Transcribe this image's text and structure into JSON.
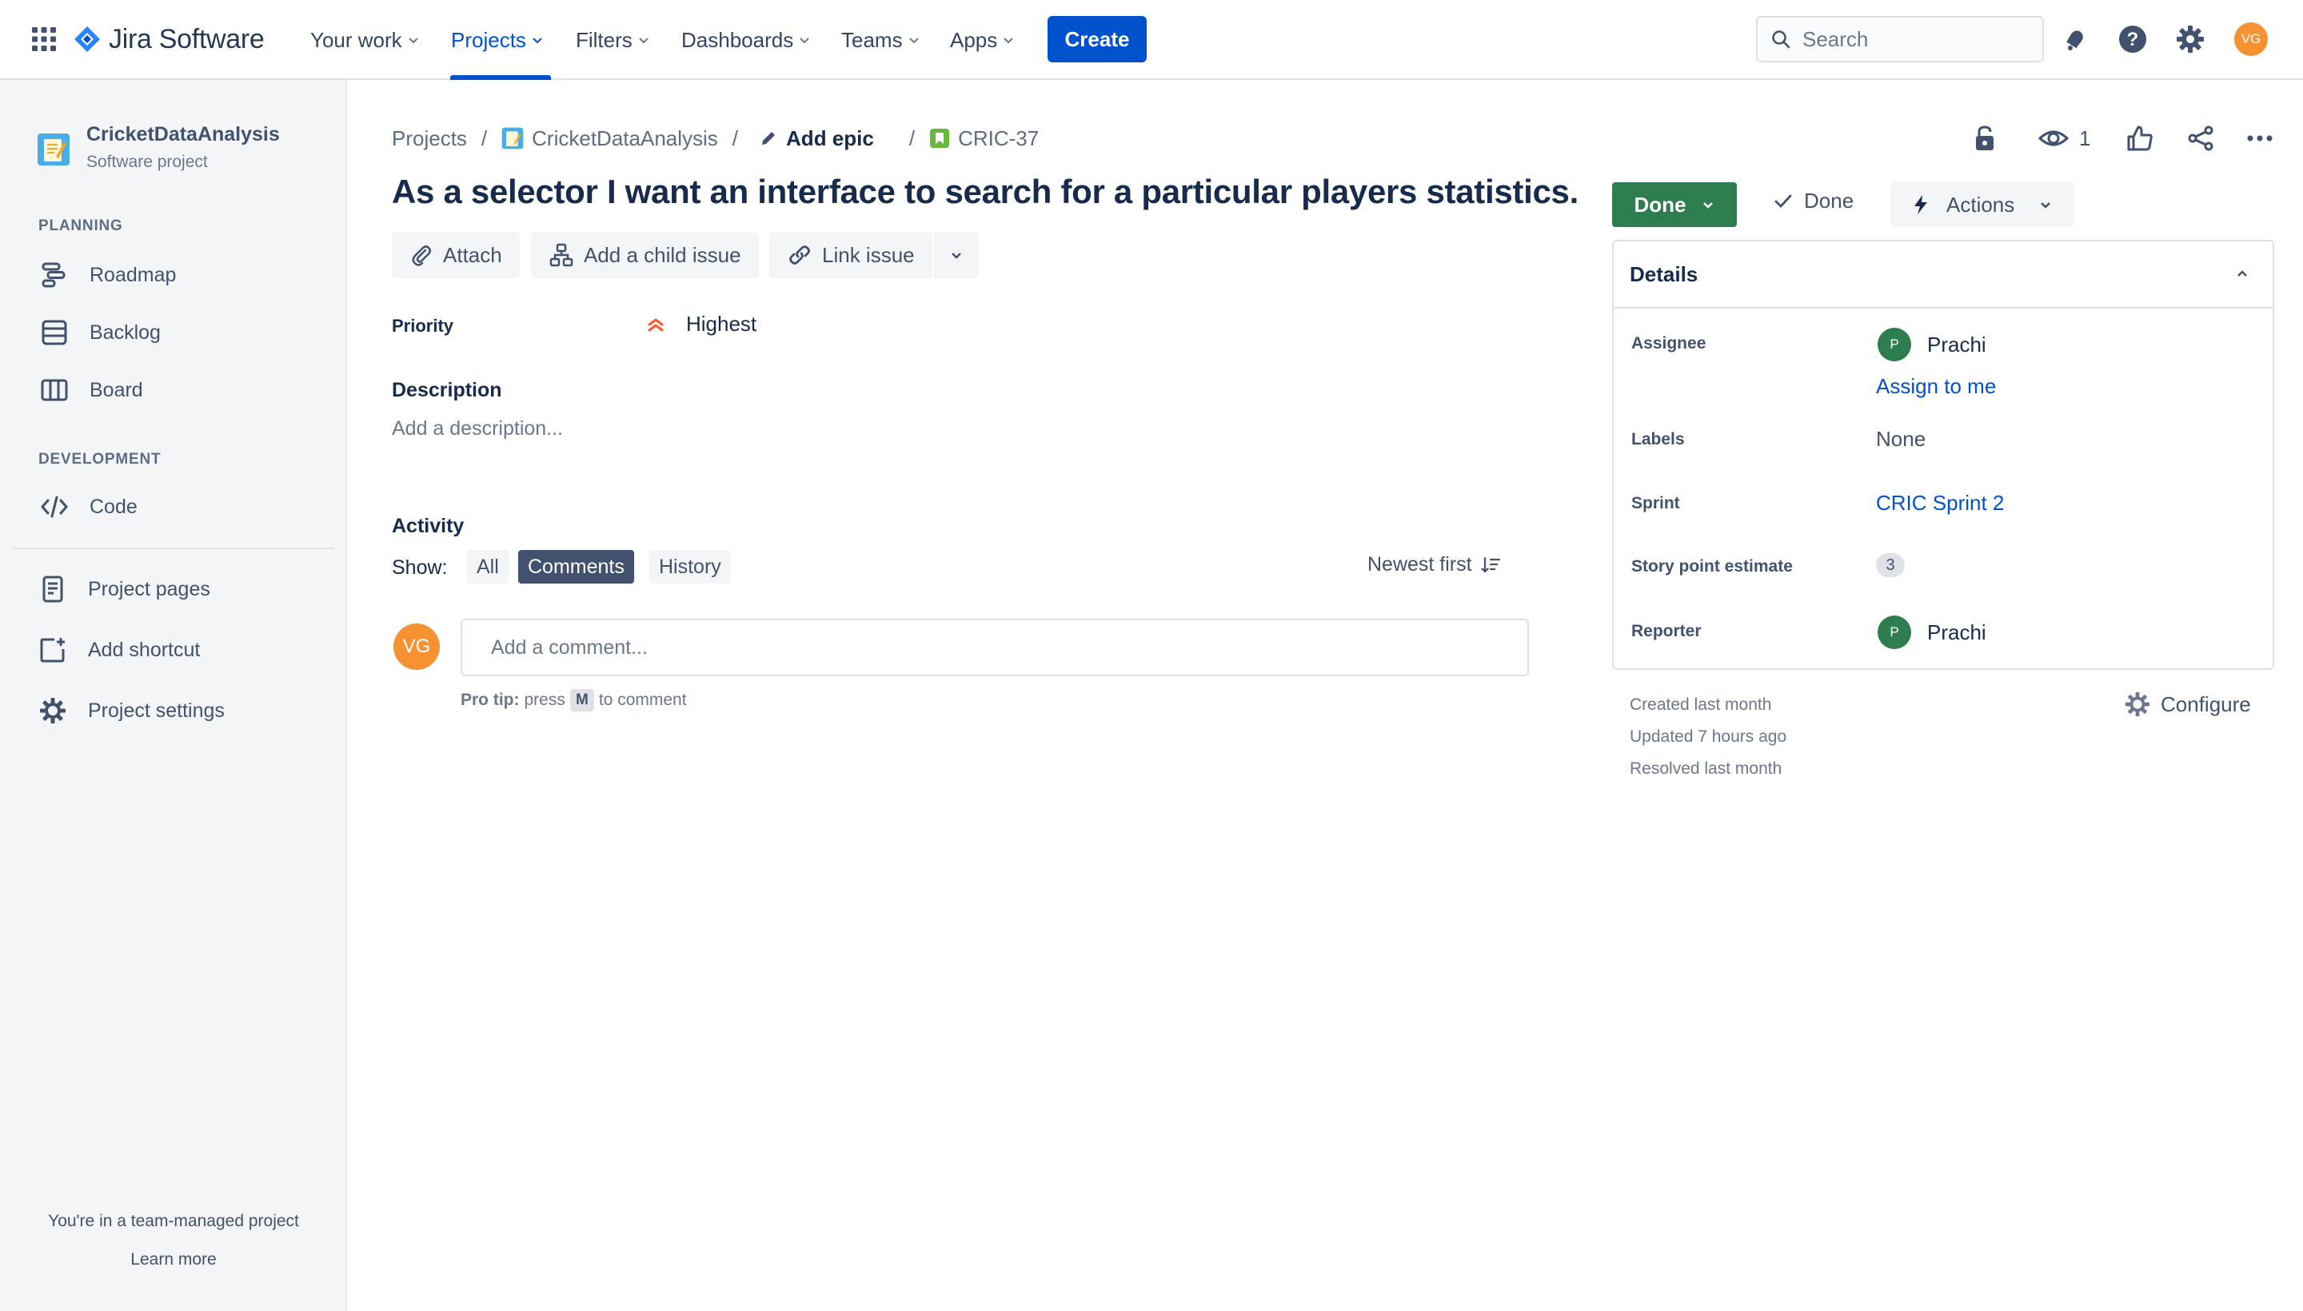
{
  "topnav": {
    "logo_text": "Jira Software",
    "items": [
      {
        "label": "Your work"
      },
      {
        "label": "Projects"
      },
      {
        "label": "Filters"
      },
      {
        "label": "Dashboards"
      },
      {
        "label": "Teams"
      },
      {
        "label": "Apps"
      }
    ],
    "active_item": "Projects",
    "create_label": "Create",
    "search_placeholder": "Search",
    "user_initials": "VG",
    "accent_color": "#0052CC"
  },
  "sidebar": {
    "project_name": "CricketDataAnalysis",
    "project_type": "Software project",
    "planning_heading": "PLANNING",
    "planning_items": [
      {
        "label": "Roadmap",
        "icon": "roadmap-icon"
      },
      {
        "label": "Backlog",
        "icon": "backlog-icon"
      },
      {
        "label": "Board",
        "icon": "board-icon"
      }
    ],
    "development_heading": "DEVELOPMENT",
    "development_items": [
      {
        "label": "Code",
        "icon": "code-icon"
      }
    ],
    "other_items": [
      {
        "label": "Project pages",
        "icon": "page-icon"
      },
      {
        "label": "Add shortcut",
        "icon": "add-shortcut-icon"
      },
      {
        "label": "Project settings",
        "icon": "gear-icon"
      }
    ],
    "footer_text": "You're in a team-managed project",
    "learn_more": "Learn more"
  },
  "issue": {
    "breadcrumb": {
      "projects": "Projects",
      "project": "CricketDataAnalysis",
      "epic": "Add epic",
      "key": "CRIC-37"
    },
    "title": "As a selector I want an interface to search for a particular players statistics.",
    "toolbar": {
      "attach": "Attach",
      "add_child": "Add a child issue",
      "link_issue": "Link issue"
    },
    "priority_label": "Priority",
    "priority_value": "Highest",
    "description_label": "Description",
    "description_placeholder": "Add a description...",
    "activity": {
      "label": "Activity",
      "show_label": "Show:",
      "filters": [
        "All",
        "Comments",
        "History"
      ],
      "active_filter": "Comments",
      "sort_label": "Newest first",
      "comment_placeholder": "Add a comment...",
      "pro_tip_label": "Pro tip:",
      "pro_tip_press": "press",
      "pro_tip_key": "M",
      "pro_tip_suffix": "to comment",
      "user_initials": "VG"
    }
  },
  "right_panel": {
    "watchers_count": "1",
    "status_label": "Done",
    "status_color": "#2E7D4F",
    "resolution_label": "Done",
    "actions_label": "Actions",
    "details": {
      "header": "Details",
      "assignee_label": "Assignee",
      "assignee_name": "Prachi",
      "assignee_initial": "P",
      "assign_to_me": "Assign to me",
      "labels_label": "Labels",
      "labels_value": "None",
      "sprint_label": "Sprint",
      "sprint_value": "CRIC Sprint 2",
      "story_points_label": "Story point estimate",
      "story_points_value": "3",
      "reporter_label": "Reporter",
      "reporter_name": "Prachi",
      "reporter_initial": "P"
    },
    "meta": {
      "created": "Created last month",
      "updated": "Updated 7 hours ago",
      "resolved": "Resolved last month"
    },
    "configure_label": "Configure"
  }
}
